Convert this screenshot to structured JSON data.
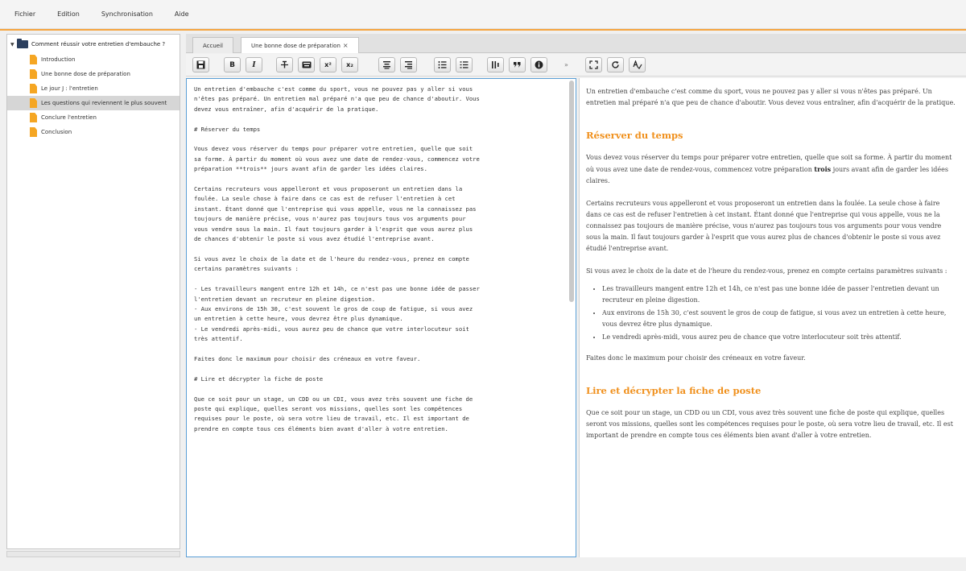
{
  "menu": [
    "Fichier",
    "Edition",
    "Synchronisation",
    "Aide"
  ],
  "tree": {
    "root": "Comment réussir votre entretien d'embauche ?",
    "items": [
      "Introduction",
      "Une bonne dose de préparation",
      "Le jour J : l'entretien",
      "Les questions qui reviennent le plus souvent",
      "Conclure l'entretien",
      "Conclusion"
    ]
  },
  "tabs": {
    "home": "Accueil",
    "active": "Une bonne dose de préparation"
  },
  "toolbar_icons": [
    "save-icon",
    "bold-icon",
    "italic-icon",
    "strikethrough-icon",
    "keyboard-icon",
    "superscript-icon",
    "subscript-icon",
    "align-center-icon",
    "align-right-icon",
    "bullet-list-icon",
    "numbered-list-icon",
    "table-icon",
    "quote-icon",
    "info-icon",
    "fullscreen-icon",
    "refresh-icon",
    "spellcheck-icon"
  ],
  "toolbar_glyphs": {
    "bold": "B",
    "italic": "I",
    "superscript": "x²",
    "subscript": "x₂",
    "more": "»"
  },
  "editor_text": "Un entretien d'embauche c'est comme du sport, vous ne pouvez pas y aller si vous\nn'êtes pas préparé. Un entretien mal préparé n'a que peu de chance d'aboutir. Vous\ndevez vous entraîner, afin d'acquérir de la pratique.\n\n# Réserver du temps\n\nVous devez vous réserver du temps pour préparer votre entretien, quelle que soit\nsa forme. À partir du moment où vous avez une date de rendez-vous, commencez votre\npréparation **trois** jours avant afin de garder les idées claires.\n\nCertains recruteurs vous appelleront et vous proposeront un entretien dans la\nfoulée. La seule chose à faire dans ce cas est de refuser l'entretien à cet\ninstant. Étant donné que l'entreprise qui vous appelle, vous ne la connaissez pas\ntoujours de manière précise, vous n'aurez pas toujours tous vos arguments pour\nvous vendre sous la main. Il faut toujours garder à l'esprit que vous aurez plus\nde chances d'obtenir le poste si vous avez étudié l'entreprise avant.\n\nSi vous avez le choix de la date et de l'heure du rendez-vous, prenez en compte\ncertains paramètres suivants :\n\n- Les travailleurs mangent entre 12h et 14h, ce n'est pas une bonne idée de passer\nl'entretien devant un recruteur en pleine digestion.\n- Aux environs de 15h 30, c'est souvent le gros de coup de fatigue, si vous avez\nun entretien à cette heure, vous devrez être plus dynamique.\n- Le vendredi après-midi, vous aurez peu de chance que votre interlocuteur soit\ntrès attentif.\n\nFaites donc le maximum pour choisir des créneaux en votre faveur.\n\n# Lire et décrypter la fiche de poste\n\nQue ce soit pour un stage, un CDD ou un CDI, vous avez très souvent une fiche de\nposte qui explique, quelles seront vos missions, quelles sont les compétences\nrequises pour le poste, où sera votre lieu de travail, etc. Il est important de\nprendre en compte tous ces éléments bien avant d'aller à votre entretien.",
  "preview": {
    "p1": "Un entretien d'embauche c'est comme du sport, vous ne pouvez pas y aller si vous n'êtes pas préparé. Un entretien mal préparé n'a que peu de chance d'aboutir. Vous devez vous entraîner, afin d'acquérir de la pratique.",
    "h1": "Réserver du temps",
    "p2a": "Vous devez vous réserver du temps pour préparer votre entretien, quelle que soit sa forme. À partir du moment où vous avez une date de rendez-vous, commencez votre préparation ",
    "p2b": "trois",
    "p2c": " jours avant afin de garder les idées claires.",
    "p3": "Certains recruteurs vous appelleront et vous proposeront un entretien dans la foulée. La seule chose à faire dans ce cas est de refuser l'entretien à cet instant. Étant donné que l'entreprise qui vous appelle, vous ne la connaissez pas toujours de manière précise, vous n'aurez pas toujours tous vos arguments pour vous vendre sous la main. Il faut toujours garder à l'esprit que vous aurez plus de chances d'obtenir le poste si vous avez étudié l'entreprise avant.",
    "p4": "Si vous avez le choix de la date et de l'heure du rendez-vous, prenez en compte certains paramètres suivants :",
    "li1": "Les travailleurs mangent entre 12h et 14h, ce n'est pas une bonne idée de passer l'entretien devant un recruteur en pleine digestion.",
    "li2": "Aux environs de 15h 30, c'est souvent le gros de coup de fatigue, si vous avez un entretien à cette heure, vous devrez être plus dynamique.",
    "li3": "Le vendredi après-midi, vous aurez peu de chance que votre interlocuteur soit très attentif.",
    "p5": "Faites donc le maximum pour choisir des créneaux en votre faveur.",
    "h2": "Lire et décrypter la fiche de poste",
    "p6": "Que ce soit pour un stage, un CDD ou un CDI, vous avez très souvent une fiche de poste qui explique, quelles seront vos missions, quelles sont les compétences requises pour le poste, où sera votre lieu de travail, etc. Il est important de prendre en compte tous ces éléments bien avant d'aller à votre entretien."
  },
  "colors": {
    "accent": "#f5a540",
    "heading": "#f0901c",
    "folder": "#2c3f5e",
    "file": "#f5a623",
    "editor_border": "#5a9fd6"
  }
}
